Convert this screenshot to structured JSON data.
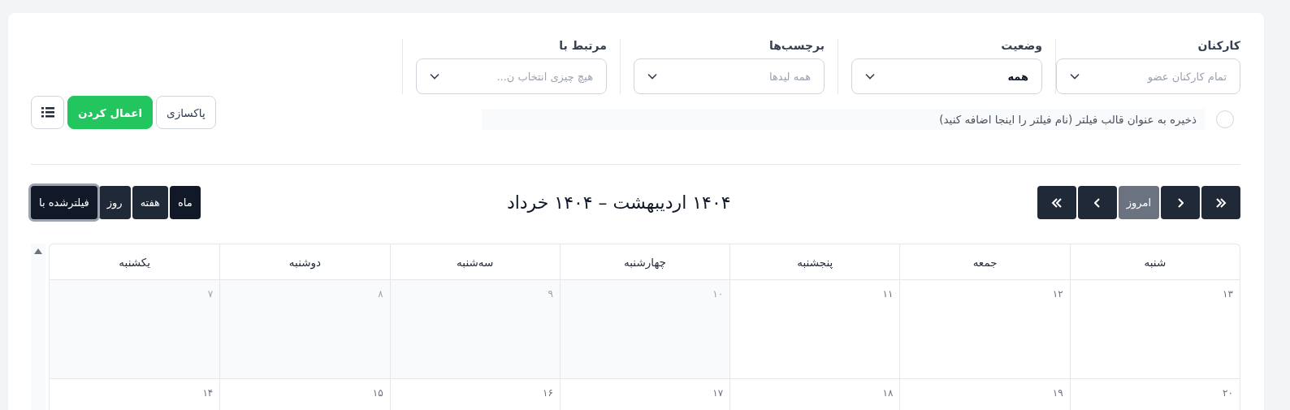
{
  "filters": [
    {
      "label": "کارکنان",
      "placeholder": "تمام کارکنان عضو"
    },
    {
      "label": "وضعیت",
      "value": "همه"
    },
    {
      "label": "برچسب‌ها",
      "placeholder": "همه لیدها"
    },
    {
      "label": "مرتبط با",
      "placeholder": "هیچ چیزی انتخاب ن..."
    }
  ],
  "save_template": {
    "label": "ذخیره به عنوان قالب فیلتر (نام فیلتر را اینجا اضافه کنید)",
    "checked": false
  },
  "buttons": {
    "clear": "پاکسازی",
    "apply": "اعمال کردن"
  },
  "calendar": {
    "title": "۱۴۰۴ اردیبهشت – ۱۴۰۴ خرداد",
    "today": "امروز",
    "views": [
      {
        "label": "ماه",
        "selected": true
      },
      {
        "label": "هفته",
        "selected": false
      },
      {
        "label": "روز",
        "selected": false
      }
    ],
    "filtered_toggle": {
      "label": "فیلترشده با",
      "focused": true
    },
    "weekdays": [
      "شنبه",
      "جمعه",
      "پنجشنبه",
      "چهارشنبه",
      "سه‌شنبه",
      "دوشنبه",
      "یکشنبه"
    ],
    "weeks": [
      [
        {
          "day": "۱۳",
          "past": false
        },
        {
          "day": "۱۲",
          "past": false
        },
        {
          "day": "۱۱",
          "past": false
        },
        {
          "day": "۱۰",
          "past": true
        },
        {
          "day": "۹",
          "past": true
        },
        {
          "day": "۸",
          "past": true
        },
        {
          "day": "۷",
          "past": true
        }
      ],
      [
        {
          "day": "۲۰",
          "past": false
        },
        {
          "day": "۱۹",
          "past": false
        },
        {
          "day": "۱۸",
          "past": false
        },
        {
          "day": "۱۷",
          "past": false
        },
        {
          "day": "۱۶",
          "past": false
        },
        {
          "day": "۱۵",
          "past": false
        },
        {
          "day": "۱۴",
          "past": false
        }
      ]
    ]
  }
}
